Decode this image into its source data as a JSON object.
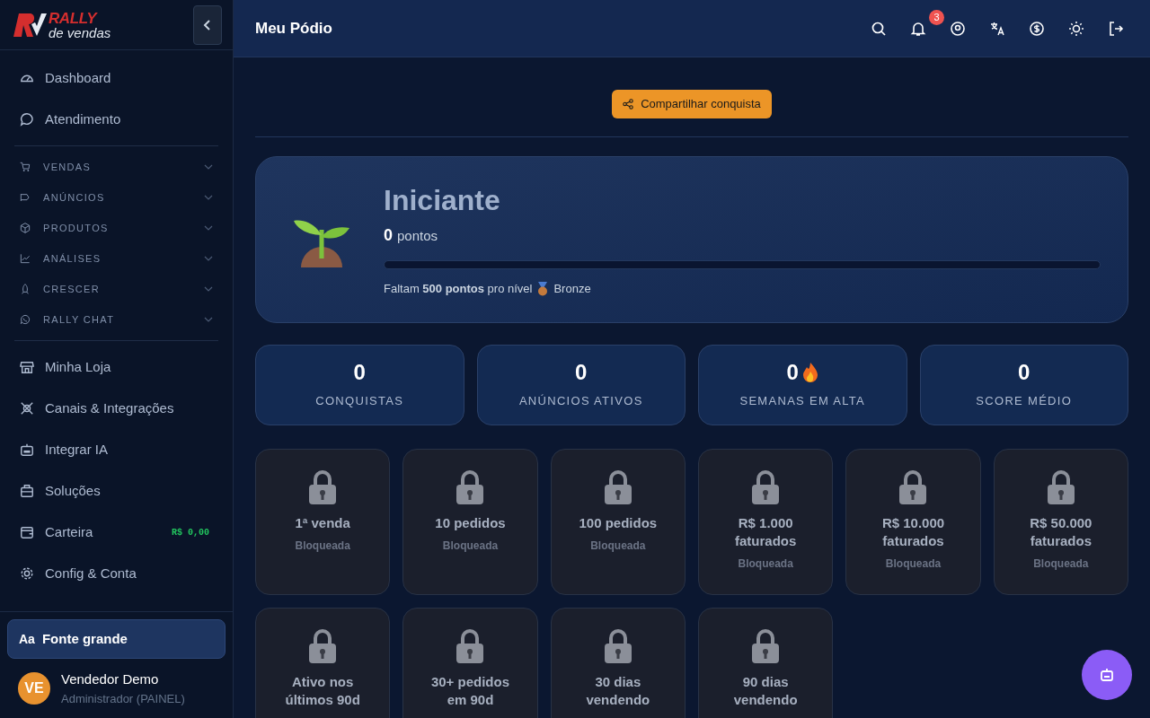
{
  "sidebar": {
    "logo": {
      "brand": "RALLY",
      "tagline": "de vendas"
    },
    "items": [
      {
        "kind": "main",
        "label": "Dashboard"
      },
      {
        "kind": "main",
        "label": "Atendimento"
      },
      {
        "kind": "divider"
      },
      {
        "kind": "section",
        "label": "VENDAS",
        "expanded": false
      },
      {
        "kind": "section",
        "label": "ANÚNCIOS",
        "expanded": false
      },
      {
        "kind": "section",
        "label": "PRODUTOS",
        "expanded": false
      },
      {
        "kind": "section",
        "label": "ANÁLISES",
        "expanded": false
      },
      {
        "kind": "section",
        "label": "CRESCER",
        "expanded": false
      },
      {
        "kind": "section",
        "label": "RALLY CHAT",
        "expanded": false
      },
      {
        "kind": "divider"
      },
      {
        "kind": "main",
        "label": "Minha Loja"
      },
      {
        "kind": "main",
        "label": "Canais & Integrações"
      },
      {
        "kind": "main",
        "label": "Integrar IA"
      },
      {
        "kind": "main",
        "label": "Soluções"
      },
      {
        "kind": "main",
        "label": "Carteira",
        "badge": "R$ 0,00"
      },
      {
        "kind": "main",
        "label": "Config & Conta"
      }
    ],
    "font_toggle": {
      "icon_text": "Aa",
      "label": "Fonte grande",
      "on": true
    },
    "user": {
      "initials": "VE",
      "name": "Vendedor Demo",
      "role": "Administrador (PAINEL)"
    }
  },
  "header": {
    "title": "Meu Pódio",
    "notification_count": "3"
  },
  "share_button": "Compartilhar conquista",
  "level_card": {
    "level": "Iniciante",
    "points": "0",
    "points_label": "pontos",
    "progress": {
      "level": 0
    },
    "next_level_text": "Faltam **500 pontos** pro nível",
    "next_level_name": "Bronze"
  },
  "stats": [
    {
      "value": "0",
      "label": "CONQUISTAS",
      "fire": false
    },
    {
      "value": "0",
      "label": "ANÚNCIOS ATIVOS",
      "fire": false
    },
    {
      "value": "0",
      "label": "SEMANAS EM ALTA",
      "fire": true
    },
    {
      "value": "0",
      "label": "SCORE MÉDIO",
      "fire": false
    }
  ],
  "achievements": [
    {
      "title": "1ª venda",
      "status": "Bloqueada",
      "locked": true
    },
    {
      "title": "10 pedidos",
      "status": "Bloqueada",
      "locked": true
    },
    {
      "title": "100 pedidos",
      "status": "Bloqueada",
      "locked": true
    },
    {
      "title": "R$ 1.000 faturados",
      "status": "Bloqueada",
      "locked": true
    },
    {
      "title": "R$ 10.000 faturados",
      "status": "Bloqueada",
      "locked": true
    },
    {
      "title": "R$ 50.000 faturados",
      "status": "Bloqueada",
      "locked": true
    },
    {
      "title": "Ativo nos últimos 90d",
      "locked": true
    },
    {
      "title": "30+ pedidos em 90d",
      "locked": true
    },
    {
      "title": "30 dias vendendo",
      "locked": true
    },
    {
      "title": "90 dias vendendo",
      "locked": true
    }
  ]
}
